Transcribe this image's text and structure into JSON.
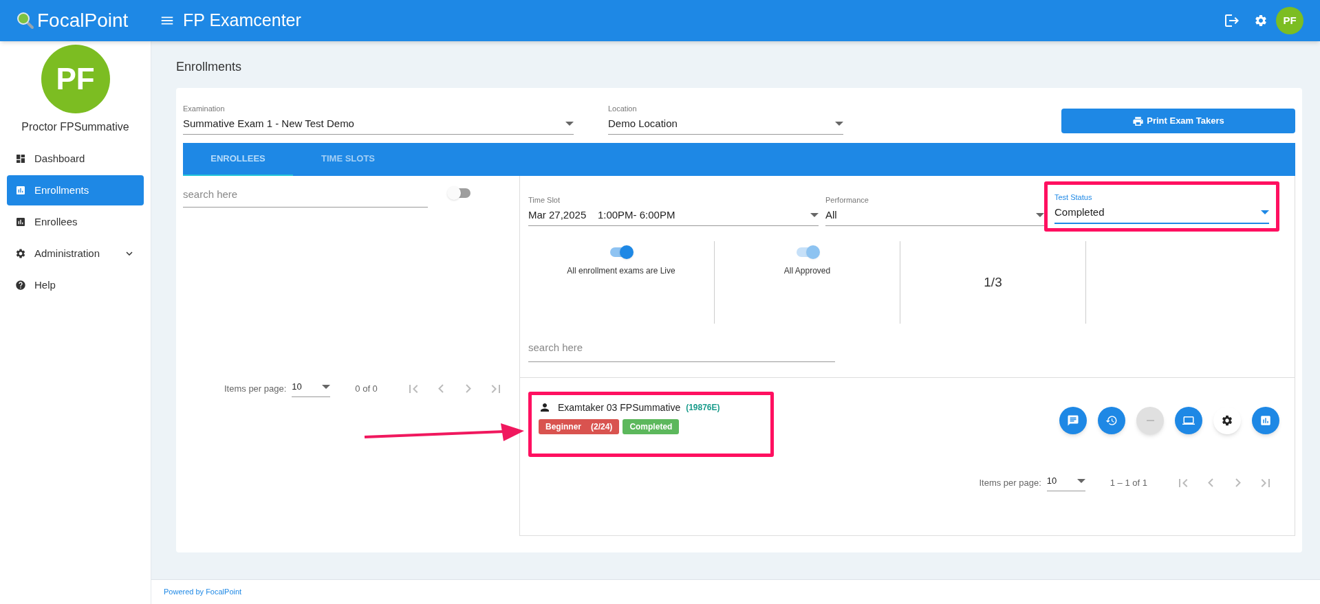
{
  "header": {
    "logo": "FocalPoint",
    "title": "FP Examcenter",
    "avatar": "PF"
  },
  "sidebar": {
    "avatar": "PF",
    "user": "Proctor FPSummative",
    "items": [
      {
        "label": "Dashboard",
        "selected": false
      },
      {
        "label": "Enrollments",
        "selected": true
      },
      {
        "label": "Enrollees",
        "selected": false
      },
      {
        "label": "Administration",
        "selected": false,
        "expanded": false
      },
      {
        "label": "Help",
        "selected": false
      }
    ]
  },
  "page_title": "Enrollments",
  "filters": {
    "examination": {
      "label": "Examination",
      "value": "Summative Exam 1 - New Test Demo"
    },
    "location": {
      "label": "Location",
      "value": "Demo Location"
    }
  },
  "print_button": "Print Exam Takers",
  "tabs": [
    {
      "label": "ENROLLEES",
      "selected": true
    },
    {
      "label": "TIME SLOTS",
      "selected": false
    }
  ],
  "left_panel": {
    "search": {
      "placeholder": "search here"
    },
    "toggle": {
      "on": false
    },
    "pagination": {
      "label": "Items per page:",
      "per_page": "10",
      "range": "0 of 0"
    }
  },
  "right_panel": {
    "time_slot": {
      "label": "Time Slot",
      "date": "Mar 27,2025",
      "time": "1:00PM- 6:00PM"
    },
    "performance": {
      "label": "Performance",
      "value": "All"
    },
    "test_status": {
      "label": "Test Status",
      "value": "Completed",
      "focused": true,
      "highlighted": true
    },
    "stats": [
      {
        "kind": "toggle",
        "label": "All enrollment exams are Live",
        "on": true,
        "disabled": false
      },
      {
        "kind": "toggle",
        "label": "All Approved",
        "on": true,
        "disabled": true
      },
      {
        "kind": "count",
        "value": "1/3"
      }
    ],
    "search": {
      "placeholder": "search here"
    },
    "enrollees": [
      {
        "name": "Examtaker 03 FPSummative",
        "code": "(19876E)",
        "highlighted": true,
        "tags": [
          {
            "label": "Beginner",
            "score": "(2/24)",
            "color": "#d9534f"
          },
          {
            "label": "Completed",
            "color": "#5cb85c"
          }
        ]
      }
    ],
    "actions": [
      {
        "disabled": false
      },
      {
        "disabled": false
      },
      {
        "disabled": true
      },
      {
        "disabled": false
      },
      {
        "disabled": false
      },
      {
        "disabled": false
      }
    ],
    "pagination": {
      "label": "Items per page:",
      "per_page": "10",
      "range": "1 – 1 of 1"
    }
  },
  "footer": "Powered by FocalPoint"
}
